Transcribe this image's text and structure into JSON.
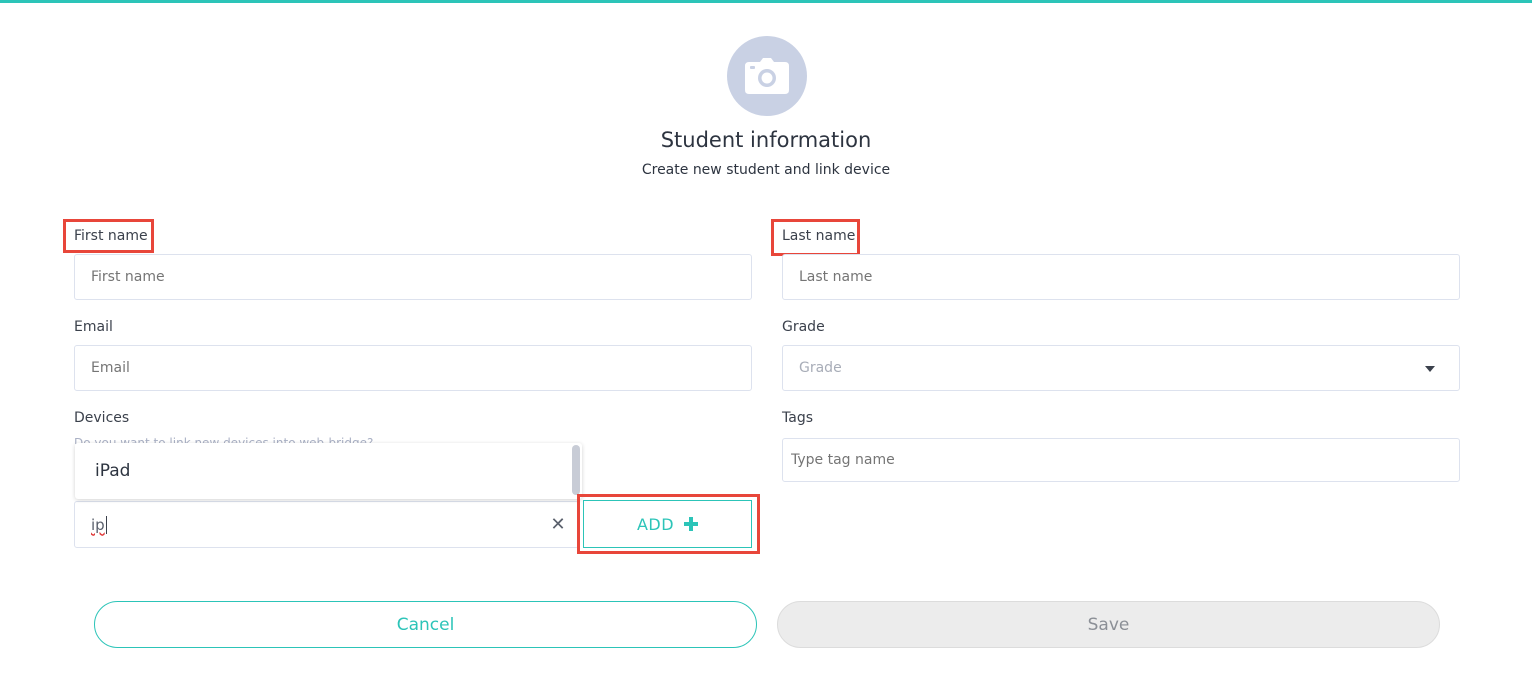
{
  "header": {
    "title": "Student information",
    "subtitle": "Create new student and link device",
    "avatar_icon": "camera-icon"
  },
  "form": {
    "first_name": {
      "label": "First name",
      "placeholder": "First name"
    },
    "last_name": {
      "label": "Last name",
      "placeholder": "Last name"
    },
    "email": {
      "label": "Email",
      "placeholder": "Email"
    },
    "grade": {
      "label": "Grade",
      "placeholder": "Grade"
    },
    "devices": {
      "label": "Devices",
      "hint": "Do you want to link new devices into web-bridge?",
      "typed_value": "ip",
      "suggestions": [
        "iPad"
      ],
      "add_label": "ADD"
    },
    "tags": {
      "label": "Tags",
      "placeholder": "Type tag name"
    }
  },
  "actions": {
    "cancel_label": "Cancel",
    "save_label": "Save"
  },
  "colors": {
    "accent": "#2cc4b8",
    "highlight": "#e8463a",
    "avatar_bg": "#c9d1e4"
  }
}
